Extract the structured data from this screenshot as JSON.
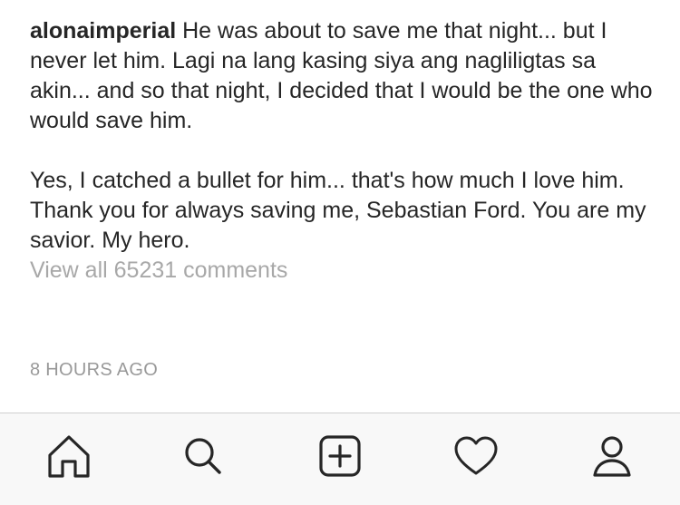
{
  "post": {
    "username": "alonaimperial",
    "caption_part1": "He was about to save me that night... but I never let him. Lagi na lang kasing siya ang nagliligtas sa akin... and so that night, I decided that I would be the one who would save him.",
    "caption_part2": "Yes, I catched a bullet for him... that's how much I love him. Thank you for always saving me, Sebastian Ford. You are my savior. My hero.",
    "view_comments": "View all 65231 comments",
    "timestamp": "8 HOURS AGO"
  },
  "tabbar": {
    "items": [
      {
        "name": "home",
        "icon": "home-icon"
      },
      {
        "name": "search",
        "icon": "search-icon"
      },
      {
        "name": "new-post",
        "icon": "plus-square-icon"
      },
      {
        "name": "activity",
        "icon": "heart-icon"
      },
      {
        "name": "profile",
        "icon": "person-icon"
      }
    ]
  },
  "colors": {
    "text": "#262626",
    "muted": "#a8a8a8",
    "timestamp": "#999999",
    "tabbar_bg": "#f8f8f8",
    "icon": "#262626"
  }
}
